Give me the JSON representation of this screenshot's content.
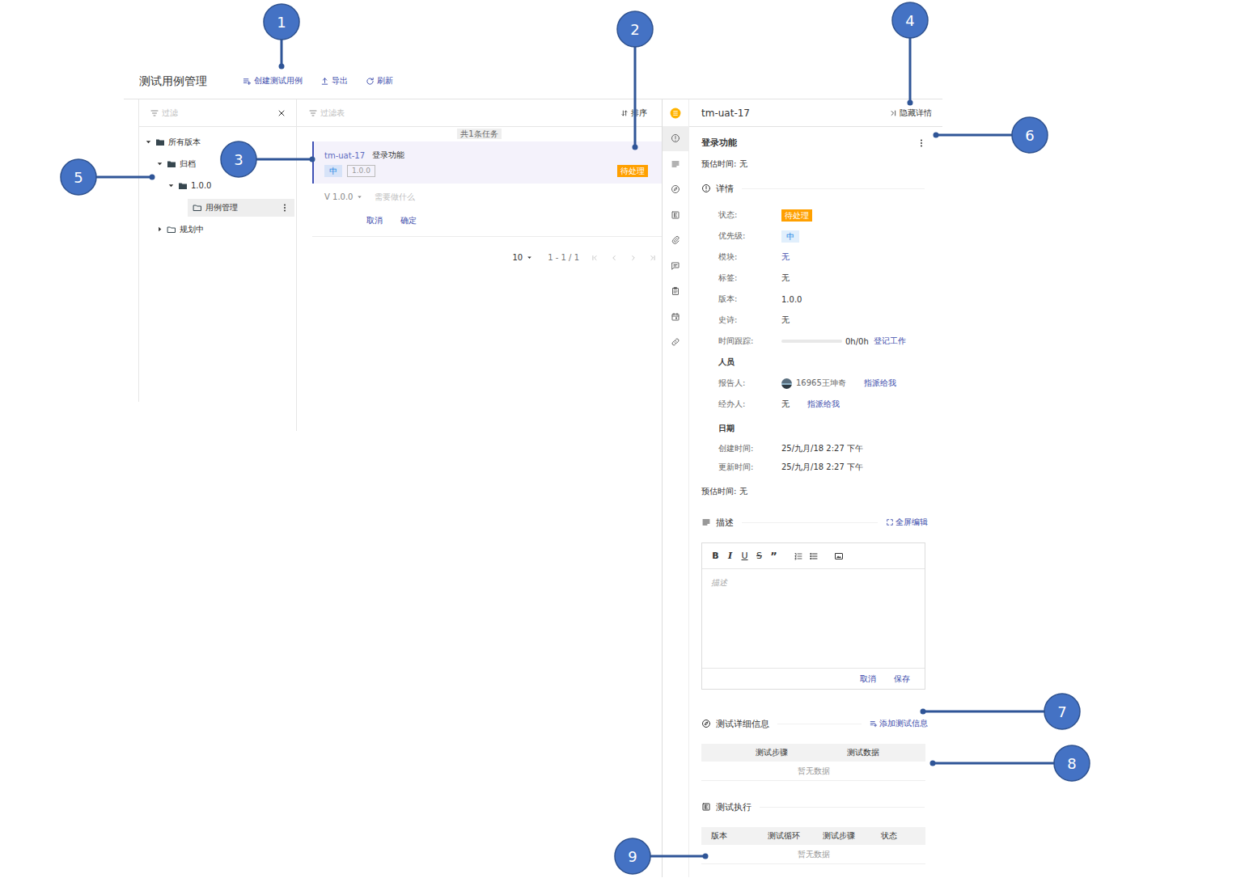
{
  "header": {
    "title": "测试用例管理",
    "actions": [
      "创建测试用例",
      "导出",
      "刷新"
    ]
  },
  "tree_panel": {
    "filter_placeholder": "过滤",
    "items": [
      {
        "label": "所有版本",
        "level": 0,
        "expanded": true,
        "has_children": true,
        "selected": false
      },
      {
        "label": "归档",
        "level": 1,
        "expanded": true,
        "has_children": true,
        "selected": false
      },
      {
        "label": "1.0.0",
        "level": 2,
        "expanded": true,
        "has_children": true,
        "selected": false
      },
      {
        "label": "用例管理",
        "level": 3,
        "expanded": false,
        "has_children": false,
        "selected": true
      },
      {
        "label": "规划中",
        "level": 1,
        "expanded": false,
        "has_children": true,
        "selected": false
      }
    ]
  },
  "list_panel": {
    "filter_placeholder": "过滤表",
    "sort_label": "排序",
    "count": "共1条任务",
    "cases": [
      {
        "key": "tm-uat-17",
        "title": "登录功能",
        "priority": {
          "text": "中",
          "color": "#1e88e5"
        },
        "version": "1.0.0",
        "status": {
          "text": "待处理",
          "color": "#ffa000"
        },
        "selected": true
      }
    ],
    "quick_create": {
      "version": "V 1.0.0",
      "placeholder": "需要做什么",
      "buttons": [
        "取消",
        "确定"
      ]
    },
    "pagination": {
      "page_size": "10",
      "range": "1 - 1 / 1"
    }
  },
  "detail": {
    "side_tabs": [
      {
        "selected": false
      },
      {
        "selected": true
      },
      {
        "selected": false
      },
      {
        "selected": false
      },
      {
        "selected": false
      },
      {
        "selected": false
      },
      {
        "selected": false
      },
      {
        "selected": false
      },
      {
        "selected": false
      },
      {
        "selected": false
      }
    ],
    "key": "tm-uat-17",
    "hide_label": "隐藏详情",
    "title": "登录功能",
    "estimate": "预估时间: 无",
    "details_heading": "详情",
    "fields": [
      {
        "label": "状态:",
        "kind": "solid-badge",
        "value": "待处理",
        "color": "#ffa000"
      },
      {
        "label": "优先级:",
        "kind": "soft-badge",
        "value": "中",
        "color": "#1e88e5"
      },
      {
        "label": "模块:",
        "kind": "link",
        "value": "无"
      },
      {
        "label": "标签:",
        "kind": "text",
        "value": "无"
      },
      {
        "label": "版本:",
        "kind": "text",
        "value": "1.0.0"
      },
      {
        "label": "史诗:",
        "kind": "text",
        "value": "无"
      },
      {
        "label": "时间跟踪:",
        "kind": "progress",
        "level": 0,
        "value": "0h/0h",
        "action": "登记工作"
      }
    ],
    "people_heading": "人员",
    "people": [
      {
        "label": "报告人:",
        "name": "16965王坤奇",
        "has_avatar": true,
        "action": "指派给我"
      },
      {
        "label": "经办人:",
        "name": "无",
        "has_avatar": false,
        "action": "指派给我"
      }
    ],
    "dates_heading": "日期",
    "dates": [
      {
        "label": "创建时间:",
        "value": "25/九月/18 2:27 下午"
      },
      {
        "label": "更新时间:",
        "value": "25/九月/18 2:27 下午"
      }
    ],
    "estimate_footer": "预估时间: 无",
    "description": {
      "heading": "描述",
      "fullscreen": "全屏编辑",
      "format_buttons": [
        "B",
        "I",
        "U",
        "S",
        "”"
      ],
      "placeholder": "描述",
      "buttons": [
        "取消",
        "保存"
      ]
    },
    "test_info": {
      "heading": "测试详细信息",
      "action": "添加测试信息",
      "columns": [
        "测试步骤",
        "测试数据"
      ],
      "empty": "暂无数据"
    },
    "executions": {
      "heading": "测试执行",
      "columns": [
        "版本",
        "测试循环",
        "测试步骤",
        "状态"
      ],
      "empty": "暂无数据"
    }
  },
  "callouts": [
    "1",
    "2",
    "3",
    "4",
    "5",
    "6",
    "7",
    "8",
    "9"
  ]
}
